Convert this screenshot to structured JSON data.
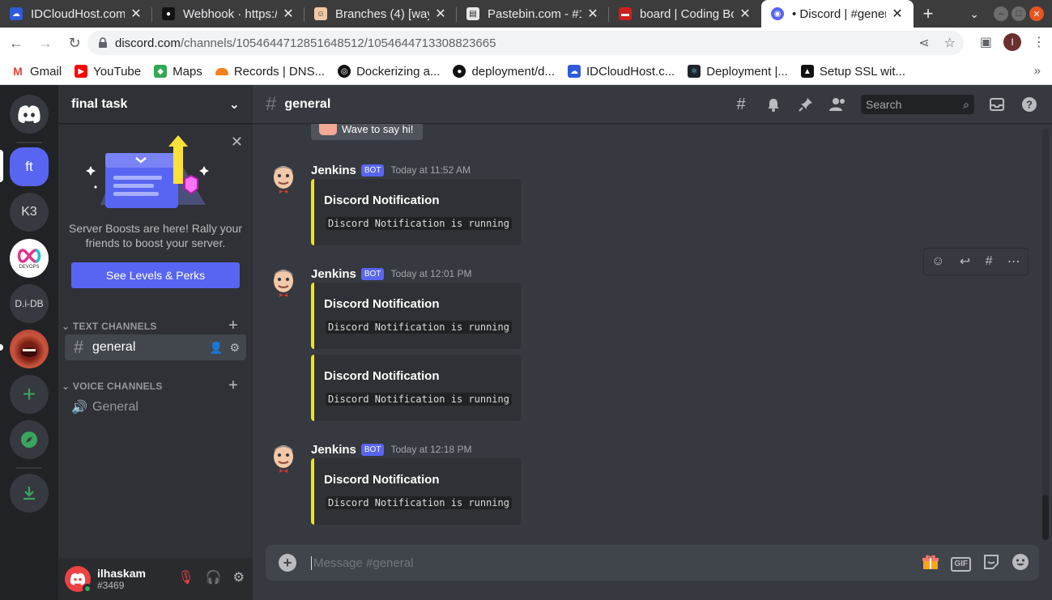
{
  "browser": {
    "tabs": [
      {
        "title": "IDCloudHost.com",
        "icon": "idcloudhost-icon",
        "color": "#2f5bd8"
      },
      {
        "title": "Webhook · https:/",
        "icon": "github-icon",
        "color": "#111111"
      },
      {
        "title": "Branches (4) [way",
        "icon": "jenkins-icon",
        "color": "#d33833"
      },
      {
        "title": "Pastebin.com - #1",
        "icon": "pastebin-icon",
        "color": "#1f1f1f"
      },
      {
        "title": "board | Coding Bo",
        "icon": "codingbootcamp-icon",
        "color": "#cc1f1f"
      },
      {
        "title": "• Discord | #gener",
        "icon": "discord-icon",
        "color": "#5865f2"
      }
    ],
    "url_host": "discord.com",
    "url_path": "/channels/1054644712851648512/1054644713308823665",
    "profile_initial": "I",
    "bookmarks": [
      {
        "label": "Gmail",
        "icon": "gmail-icon",
        "color": "#ea4335"
      },
      {
        "label": "YouTube",
        "icon": "youtube-icon",
        "color": "#ff0000"
      },
      {
        "label": "Maps",
        "icon": "maps-icon",
        "color": "#34a853"
      },
      {
        "label": "Records | DNS...",
        "icon": "cloudflare-icon",
        "color": "#f38020"
      },
      {
        "label": "Dockerizing a...",
        "icon": "docker-icon",
        "color": "#111111"
      },
      {
        "label": "deployment/d...",
        "icon": "github-icon",
        "color": "#111111"
      },
      {
        "label": "IDCloudHost.c...",
        "icon": "idcloudhost-icon",
        "color": "#2f5bd8"
      },
      {
        "label": "Deployment |...",
        "icon": "react-icon",
        "color": "#20232a"
      },
      {
        "label": "Setup SSL wit...",
        "icon": "ssl-icon",
        "color": "#111111"
      }
    ]
  },
  "guilds": [
    {
      "label": "ft",
      "name": "guild-final-task"
    },
    {
      "label": "K3",
      "name": "guild-k3"
    },
    {
      "label": "DEVOPS",
      "name": "guild-devops"
    },
    {
      "label": "D.i-DB",
      "name": "guild-di-db"
    }
  ],
  "server": {
    "name": "final task",
    "boost_text": "Server Boosts are here! Rally your friends to boost your server.",
    "boost_button": "See Levels & Perks",
    "text_category": "TEXT CHANNELS",
    "voice_category": "VOICE CHANNELS",
    "text_channel": "general",
    "voice_channel": "General"
  },
  "user": {
    "name": "ilhaskam",
    "tag": "#3469"
  },
  "channel": {
    "name": "general",
    "search_placeholder": "Search"
  },
  "wave": "Wave to say hi!",
  "messages": [
    {
      "author": "Jenkins",
      "badge": "BOT",
      "time": "Today at 11:52 AM",
      "embeds": [
        {
          "title": "Discord Notification",
          "desc": "Discord Notification is running"
        }
      ]
    },
    {
      "author": "Jenkins",
      "badge": "BOT",
      "time": "Today at 12:01 PM",
      "embeds": [
        {
          "title": "Discord Notification",
          "desc": "Discord Notification is running"
        },
        {
          "title": "Discord Notification",
          "desc": "Discord Notification is running"
        }
      ]
    },
    {
      "author": "Jenkins",
      "badge": "BOT",
      "time": "Today at 12:18 PM",
      "embeds": [
        {
          "title": "Discord Notification",
          "desc": "Discord Notification is running"
        }
      ]
    }
  ],
  "composer": {
    "placeholder": "Message #general",
    "gif_label": "GIF"
  },
  "colors": {
    "blurple": "#5865f2",
    "embed_accent": "#f1e40f",
    "green": "#3ba55d",
    "red": "#ed4245"
  }
}
